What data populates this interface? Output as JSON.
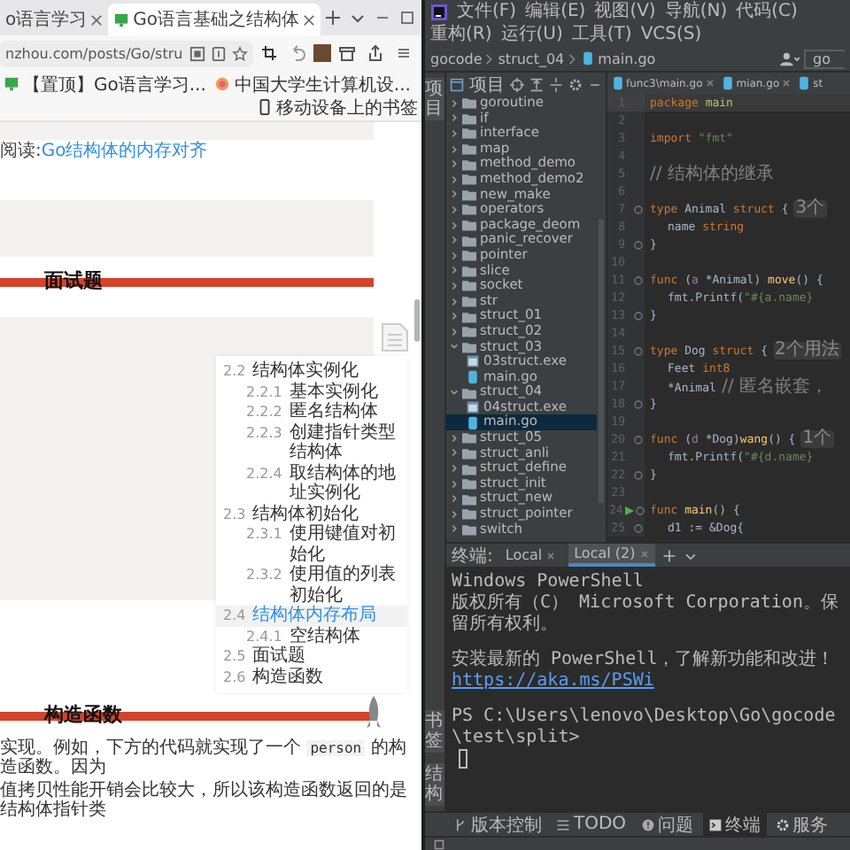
{
  "browser": {
    "tabs": [
      {
        "title": "o语言学习",
        "selected": false
      },
      {
        "title": "Go语言基础之结构体",
        "selected": true
      }
    ],
    "address": "nzhou.com/posts/Go/stru",
    "bookmarks": [
      "【置顶】Go语言学习...",
      "中国大学生计算机设..."
    ],
    "mobile_bookmarks": "移动设备上的书签",
    "article": {
      "reading_label": "阅读:",
      "reading_link": "Go结构体的内存对齐",
      "headings": [
        "面试题",
        "构造函数"
      ],
      "paragraph_lines": [
        [
          {
            "kind": "text",
            "text": "实现。例如，下方的代码就实现了一个 "
          },
          {
            "kind": "code",
            "text": "person"
          },
          {
            "kind": "text",
            "text": " 的构造函数。因为"
          }
        ],
        [
          {
            "kind": "text",
            "text": "值拷贝性能开销会比较大，所以该构造函数返回的是结构体指针类"
          }
        ]
      ]
    },
    "toc": [
      {
        "number": "2.2",
        "title": "结构体实例化",
        "selected": false,
        "children": [
          {
            "number": "2.2.1",
            "title": "基本实例化",
            "selected": false
          },
          {
            "number": "2.2.2",
            "title": "匿名结构体",
            "selected": false
          },
          {
            "number": "2.2.3",
            "title": "创建指针类型结构体",
            "selected": false
          },
          {
            "number": "2.2.4",
            "title": "取结构体的地址实例化",
            "selected": false
          }
        ]
      },
      {
        "number": "2.3",
        "title": "结构体初始化",
        "selected": false,
        "children": [
          {
            "number": "2.3.1",
            "title": "使用键值对初始化",
            "selected": false
          },
          {
            "number": "2.3.2",
            "title": "使用值的列表初始化",
            "selected": false
          }
        ]
      },
      {
        "number": "2.4",
        "title": "结构体内存布局",
        "selected": true,
        "children": [
          {
            "number": "2.4.1",
            "title": "空结构体",
            "selected": false
          }
        ]
      },
      {
        "number": "2.5",
        "title": "面试题",
        "selected": false
      },
      {
        "number": "2.6",
        "title": "构造函数",
        "selected": false
      }
    ]
  },
  "ide": {
    "menu": [
      "文件(F)",
      "编辑(E)",
      "视图(V)",
      "导航(N)",
      "代码(C)",
      "重构(R)",
      "运行(U)",
      "工具(T)",
      "VCS(S)"
    ],
    "breadcrumb": [
      "gocode",
      "struct_04",
      "main.go"
    ],
    "run_config": "go",
    "stripe_top": "项目",
    "stripe_bottom": [
      "书签",
      "结构"
    ],
    "project": {
      "title": "项目",
      "tree": [
        {
          "name": "goroutine",
          "kind": "folder",
          "expanded": false,
          "selected": false
        },
        {
          "name": "if",
          "kind": "folder",
          "expanded": false,
          "selected": false
        },
        {
          "name": "interface",
          "kind": "folder",
          "expanded": false,
          "selected": false
        },
        {
          "name": "map",
          "kind": "folder",
          "expanded": false,
          "selected": false
        },
        {
          "name": "method_demo",
          "kind": "folder",
          "expanded": false,
          "selected": false
        },
        {
          "name": "method_demo2",
          "kind": "folder",
          "expanded": false,
          "selected": false
        },
        {
          "name": "new_make",
          "kind": "folder",
          "expanded": false,
          "selected": false
        },
        {
          "name": "operators",
          "kind": "folder",
          "expanded": false,
          "selected": false
        },
        {
          "name": "package_deom",
          "kind": "folder",
          "expanded": false,
          "selected": false
        },
        {
          "name": "panic_recover",
          "kind": "folder",
          "expanded": false,
          "selected": false
        },
        {
          "name": "pointer",
          "kind": "folder",
          "expanded": false,
          "selected": false
        },
        {
          "name": "slice",
          "kind": "folder",
          "expanded": false,
          "selected": false
        },
        {
          "name": "socket",
          "kind": "folder",
          "expanded": false,
          "selected": false
        },
        {
          "name": "str",
          "kind": "folder",
          "expanded": false,
          "selected": false
        },
        {
          "name": "struct_01",
          "kind": "folder",
          "expanded": false,
          "selected": false
        },
        {
          "name": "struct_02",
          "kind": "folder",
          "expanded": false,
          "selected": false
        },
        {
          "name": "struct_03",
          "kind": "folder",
          "expanded": true,
          "selected": false,
          "children": [
            {
              "name": "03struct.exe",
              "kind": "exe",
              "selected": false
            },
            {
              "name": "main.go",
              "kind": "go",
              "selected": false
            }
          ]
        },
        {
          "name": "struct_04",
          "kind": "folder",
          "expanded": true,
          "selected": false,
          "children": [
            {
              "name": "04struct.exe",
              "kind": "exe",
              "selected": false
            },
            {
              "name": "main.go",
              "kind": "go",
              "selected": true
            }
          ]
        },
        {
          "name": "struct_05",
          "kind": "folder",
          "expanded": false,
          "selected": false
        },
        {
          "name": "struct_anli",
          "kind": "folder",
          "expanded": false,
          "selected": false
        },
        {
          "name": "struct_define",
          "kind": "folder",
          "expanded": false,
          "selected": false
        },
        {
          "name": "struct_init",
          "kind": "folder",
          "expanded": false,
          "selected": false
        },
        {
          "name": "struct_new",
          "kind": "folder",
          "expanded": false,
          "selected": false
        },
        {
          "name": "struct_pointer",
          "kind": "folder",
          "expanded": false,
          "selected": false
        },
        {
          "name": "switch",
          "kind": "folder",
          "expanded": false,
          "selected": false
        }
      ]
    },
    "editor": {
      "tabs": [
        {
          "title": "func3\\main.go",
          "selected": false
        },
        {
          "title": "mian.go",
          "selected": false
        },
        {
          "title": "st",
          "selected": false
        }
      ],
      "lines": [
        {
          "number": "1",
          "current": true,
          "tokens": [
            {
              "kind": "kw",
              "text": "package"
            },
            {
              "kind": "pkg",
              "text": " main"
            }
          ]
        },
        {
          "number": "2",
          "current": false
        },
        {
          "number": "3",
          "current": false,
          "tokens": [
            {
              "kind": "kw",
              "text": "import"
            },
            {
              "kind": "str",
              "text": " \"fmt\""
            }
          ]
        },
        {
          "number": "4",
          "current": false
        },
        {
          "number": "5",
          "current": false,
          "tokens": [
            {
              "kind": "comment",
              "text": "// 结构体的继承"
            }
          ]
        },
        {
          "number": "6",
          "current": false
        },
        {
          "number": "7",
          "current": false,
          "kind": "fold",
          "hint": "3个",
          "tokens": [
            {
              "kind": "kw",
              "text": "type"
            },
            {
              "kind": "type",
              "text": " Animal"
            },
            {
              "kind": "kw",
              "text": " struct"
            },
            {
              "kind": "plain",
              "text": " {"
            }
          ]
        },
        {
          "number": "8",
          "current": false,
          "indent": true,
          "tokens": [
            {
              "kind": "field",
              "text": "name"
            },
            {
              "kind": "kw",
              "text": " string"
            }
          ]
        },
        {
          "number": "9",
          "current": false,
          "kind": "fold",
          "tokens": [
            {
              "kind": "plain",
              "text": "}"
            }
          ]
        },
        {
          "number": "10",
          "current": false
        },
        {
          "number": "11",
          "current": false,
          "kind": "fold",
          "tokens": [
            {
              "kind": "kw",
              "text": "func"
            },
            {
              "kind": "plain",
              "text": " ("
            },
            {
              "kind": "param",
              "text": "a"
            },
            {
              "kind": "plain",
              "text": " *"
            },
            {
              "kind": "type",
              "text": "Animal"
            },
            {
              "kind": "plain",
              "text": ") "
            },
            {
              "kind": "fn",
              "text": "move"
            },
            {
              "kind": "plain",
              "text": "() {"
            }
          ]
        },
        {
          "number": "12",
          "current": false,
          "indent": true,
          "tokens": [
            {
              "kind": "plain",
              "text": "fmt.Printf("
            },
            {
              "kind": "str",
              "text": "\"#{a.name}"
            }
          ]
        },
        {
          "number": "13",
          "current": false,
          "kind": "fold",
          "tokens": [
            {
              "kind": "plain",
              "text": "}"
            }
          ]
        },
        {
          "number": "14",
          "current": false
        },
        {
          "number": "15",
          "current": false,
          "kind": "fold",
          "hint": "2个用法",
          "tokens": [
            {
              "kind": "kw",
              "text": "type"
            },
            {
              "kind": "type",
              "text": " Dog"
            },
            {
              "kind": "kw",
              "text": " struct"
            },
            {
              "kind": "plain",
              "text": " {"
            }
          ]
        },
        {
          "number": "16",
          "current": false,
          "indent": true,
          "tokens": [
            {
              "kind": "field",
              "text": "Feet"
            },
            {
              "kind": "kw",
              "text": " int8"
            }
          ]
        },
        {
          "number": "17",
          "current": false,
          "indent": true,
          "tokens": [
            {
              "kind": "type",
              "text": "*Animal"
            },
            {
              "kind": "comment",
              "text": " // 匿名嵌套，"
            }
          ]
        },
        {
          "number": "18",
          "current": false,
          "kind": "fold",
          "tokens": [
            {
              "kind": "plain",
              "text": "}"
            }
          ]
        },
        {
          "number": "19",
          "current": false
        },
        {
          "number": "20",
          "current": false,
          "kind": "fold",
          "hint": "1个",
          "tokens": [
            {
              "kind": "kw",
              "text": "func"
            },
            {
              "kind": "plain",
              "text": " ("
            },
            {
              "kind": "param",
              "text": "d"
            },
            {
              "kind": "plain",
              "text": " *"
            },
            {
              "kind": "type",
              "text": "Dog"
            },
            {
              "kind": "plain",
              "text": ")"
            },
            {
              "kind": "fn",
              "text": "wang"
            },
            {
              "kind": "plain",
              "text": "() {"
            }
          ]
        },
        {
          "number": "21",
          "current": false,
          "indent": true,
          "tokens": [
            {
              "kind": "plain",
              "text": "fmt.Printf("
            },
            {
              "kind": "str",
              "text": "\"#{d.name}"
            }
          ]
        },
        {
          "number": "22",
          "current": false,
          "kind": "fold",
          "tokens": [
            {
              "kind": "plain",
              "text": "}"
            }
          ]
        },
        {
          "number": "23",
          "current": false
        },
        {
          "number": "24",
          "current": false,
          "kind": "run",
          "tokens": [
            {
              "kind": "kw",
              "text": "func"
            },
            {
              "kind": "fn",
              "text": " main"
            },
            {
              "kind": "plain",
              "text": "() {"
            }
          ]
        },
        {
          "number": "25",
          "current": false,
          "kind": "fold",
          "indent": true,
          "tokens": [
            {
              "kind": "plain",
              "text": "d1 := &"
            },
            {
              "kind": "type",
              "text": "Dog"
            },
            {
              "kind": "plain",
              "text": "{"
            }
          ]
        }
      ]
    },
    "terminal": {
      "label": "终端:",
      "tabs": [
        {
          "title": "Local",
          "selected": false
        },
        {
          "title": "Local (2)",
          "selected": true
        }
      ],
      "lines": [
        {
          "kind": "output",
          "text": "Windows PowerShell"
        },
        {
          "kind": "output",
          "text": "版权所有（C） Microsoft Corporation。保留所有权利。"
        },
        {
          "kind": "blank"
        },
        {
          "kind": "output",
          "text": "安装最新的 PowerShell，了解新功能和改进！",
          "link": "https://aka.ms/PSWi"
        },
        {
          "kind": "blank"
        },
        {
          "kind": "prompt",
          "text": "PS C:\\Users\\lenovo\\Desktop\\Go\\gocode\\test\\split>"
        }
      ]
    },
    "tool_tabs": [
      {
        "label": "版本控制",
        "selected": false
      },
      {
        "label": "TODO",
        "selected": false
      },
      {
        "label": "问题",
        "selected": false
      },
      {
        "label": "终端",
        "selected": true
      },
      {
        "label": "服务",
        "selected": false
      }
    ]
  }
}
